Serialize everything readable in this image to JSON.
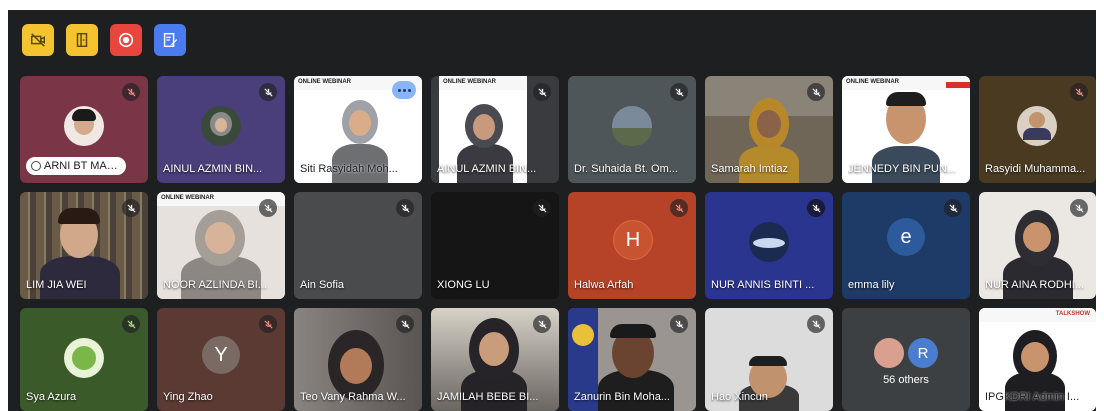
{
  "toolbar": {
    "buttons": [
      {
        "name": "camera-off-icon",
        "color": "#f4c430"
      },
      {
        "name": "door-exit-icon",
        "color": "#f4c430"
      },
      {
        "name": "record-icon",
        "color": "#e8453c"
      },
      {
        "name": "edit-note-icon",
        "color": "#4a7cf0"
      }
    ]
  },
  "participants": [
    {
      "name": "ARNI BT MAJO...",
      "bg": "#7a3546",
      "mic": "red"
    },
    {
      "name": "AINUL AZMIN BIN...",
      "bg": "#4a3f7a",
      "mic": "normal"
    },
    {
      "name": "Siti Rasyidah Moh...",
      "bg": "#e9e9ee",
      "mic": "none"
    },
    {
      "name": "AINUL AZMIN BIN...",
      "bg": "#3a3b3f",
      "mic": "normal"
    },
    {
      "name": "Dr. Suhaida Bt. Om...",
      "bg": "#4f5659",
      "mic": "normal"
    },
    {
      "name": "Samarah Imtiaz",
      "bg": "#6f6658",
      "mic": "normal"
    },
    {
      "name": "JENNEDY BIN PUN...",
      "bg": "#c9c9c9",
      "mic": "normal"
    },
    {
      "name": "Rasyidi Muhamma...",
      "bg": "#4a3a22",
      "mic": "red"
    },
    {
      "name": "LIM JIA WEI",
      "bg": "#5c5448",
      "mic": "normal"
    },
    {
      "name": "NOOR AZLINDA BI...",
      "bg": "#d8d3cf",
      "mic": "normal"
    },
    {
      "name": "Ain Sofia",
      "bg": "#4a4b4d",
      "mic": "normal"
    },
    {
      "name": "XIONG LU",
      "bg": "#151516",
      "mic": "normal"
    },
    {
      "name": "Halwa Arfah",
      "bg": "#b64327",
      "mic": "red",
      "initial": "H",
      "avatar": "#c85330"
    },
    {
      "name": "NUR ANNIS BINTI ...",
      "bg": "#2a3590",
      "mic": "blue"
    },
    {
      "name": "emma lily",
      "bg": "#1e3a66",
      "mic": "normal",
      "initial": "e",
      "avatar": "#2c5a9b"
    },
    {
      "name": "NUR AINA RODHI...",
      "bg": "#ebe8e4",
      "mic": "normal"
    },
    {
      "name": "Sya Azura",
      "bg": "#3b5a2a",
      "mic": "green"
    },
    {
      "name": "Ying Zhao",
      "bg": "#5a3a33",
      "mic": "red",
      "initial": "Y",
      "avatar": "#7a6a64"
    },
    {
      "name": "Teo Vany Rahma W...",
      "bg": "#6a6462",
      "mic": "normal"
    },
    {
      "name": "JAMILAH BEBE BI...",
      "bg": "#6d6b66",
      "mic": "normal"
    },
    {
      "name": "Zanurin Bin Moha...",
      "bg": "#9a9590",
      "mic": "normal"
    },
    {
      "name": "Hao Xincun",
      "bg": "#dcdcdc",
      "mic": "normal"
    },
    {
      "name": "IPGKDRI Admin I...",
      "bg": "#f0f0f0",
      "mic": "normal"
    }
  ],
  "others": {
    "label": "56 others",
    "letter": "R"
  },
  "slide_text": "ONLINE WEBINAR",
  "slide_text_2": "TALKSHOW"
}
